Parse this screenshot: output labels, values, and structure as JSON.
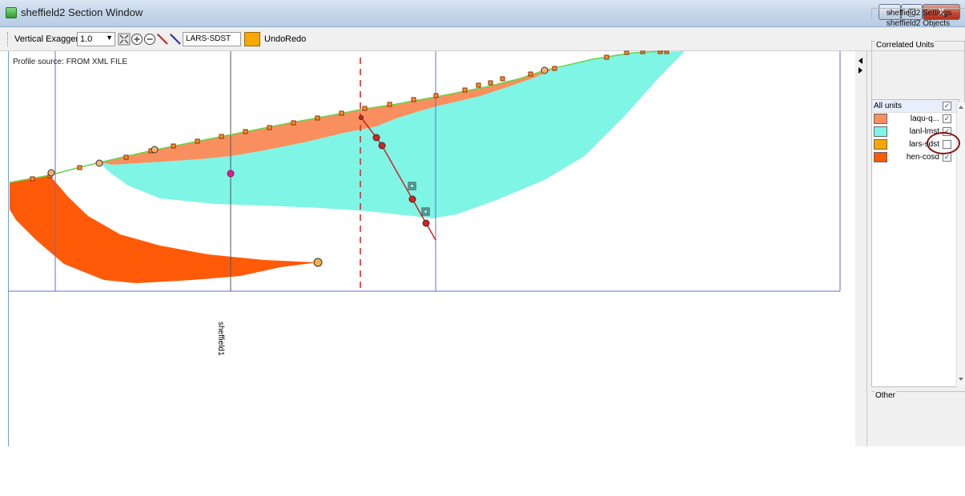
{
  "window": {
    "title": "sheffield2 Section Window",
    "controls": {
      "minimize": "‒",
      "maximize": "▢",
      "close": "X"
    }
  },
  "toolbar": {
    "vexag_label": "Vertical Exaggeration",
    "vexag_value": "1.0",
    "unit_name": "LARS-SDST",
    "swatch_color": "#f7a800",
    "undo": "Undo",
    "redo": "Redo"
  },
  "canvas": {
    "profile_source": "Profile source: FROM XML FILE",
    "well_label": "sheffield1"
  },
  "panel": {
    "tab_settings": "sheffield2 Settings",
    "tab_objects": "sheffield2 Objects",
    "correlated_title": "Correlated Units",
    "all_units_label": "All units",
    "all_units_checked": true,
    "units": [
      {
        "name": "laqu-q...",
        "color": "#f98f5e",
        "checked": true
      },
      {
        "name": "lanl-lmst",
        "color": "#7ff5e6",
        "checked": true
      },
      {
        "name": "lars-sdst",
        "color": "#f7a800",
        "checked": false
      },
      {
        "name": "hen-cosd",
        "color": "#ff5a08",
        "checked": true
      }
    ],
    "other_title": "Other"
  },
  "colors": {
    "laqu": "#f98f5e",
    "lanl": "#7ff5e6",
    "hen": "#ff5a08",
    "surface_line": "#66d44a",
    "grid_line": "#6a6ad8",
    "fault": "#d62020",
    "highlight": "#8a1010"
  }
}
